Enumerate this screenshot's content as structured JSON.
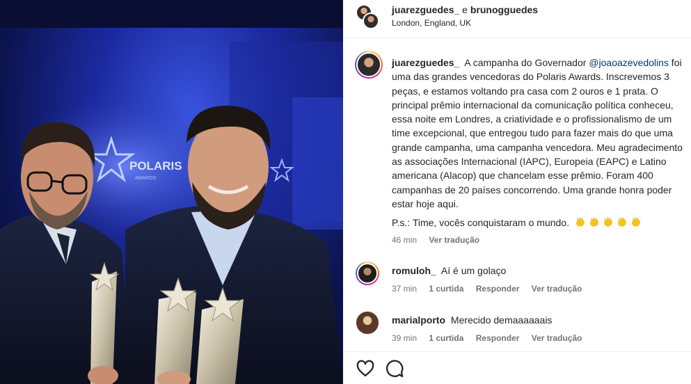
{
  "post": {
    "header": {
      "user1": "juarezguedes_",
      "joiner": " e ",
      "user2": "brunogguedes",
      "location": "London, England, UK"
    },
    "photo": {
      "backdrop_text": "POLARIS",
      "backdrop_subtext": "AWARDS"
    },
    "caption": {
      "username": "juarezguedes_",
      "text_before_mention": "A campanha do Governador ",
      "mention": "@joaoazevedolins",
      "text_after_mention": " foi uma das grandes vencedoras do Polaris Awards. Inscrevemos 3 peças, e estamos voltando pra casa com 2 ouros e 1 prata. O principal prêmio internacional da comunicação política conheceu, essa noite em Londres, a criatividade e o profissionalismo de um time excepcional, que entregou tudo para fazer mais do que uma grande campanha, uma campanha vencedora. Meu agradecimento as associações Internacional (IAPC), Europeia (EAPC) e Latino americana (Alacop) que chancelam esse prêmio. Foram 400 campanhas de 20 países concorrendo. Uma grande honra poder estar hoje aqui.",
      "ps": "P.s.: Time, vocês conquistaram o mundo.",
      "ps_emoji": "clapping-hands-emoji",
      "ps_emoji_count": 5,
      "time": "46 min",
      "see_translation": "Ver tradução"
    },
    "comments": [
      {
        "username": "romuloh_",
        "text": "Aí é um golaço",
        "time": "37 min",
        "likes": "1 curtida",
        "reply": "Responder",
        "see_translation": "Ver tradução"
      },
      {
        "username": "marialporto",
        "text": "Merecido demaaaaaais",
        "time": "39 min",
        "likes": "1 curtida",
        "reply": "Responder",
        "see_translation": "Ver tradução"
      }
    ],
    "actions": {
      "like_icon": "heart-icon",
      "comment_icon": "comment-icon"
    },
    "colors": {
      "mention": "#00376b",
      "meta_text": "#737373",
      "clap_yellow": "#f5c418"
    }
  }
}
